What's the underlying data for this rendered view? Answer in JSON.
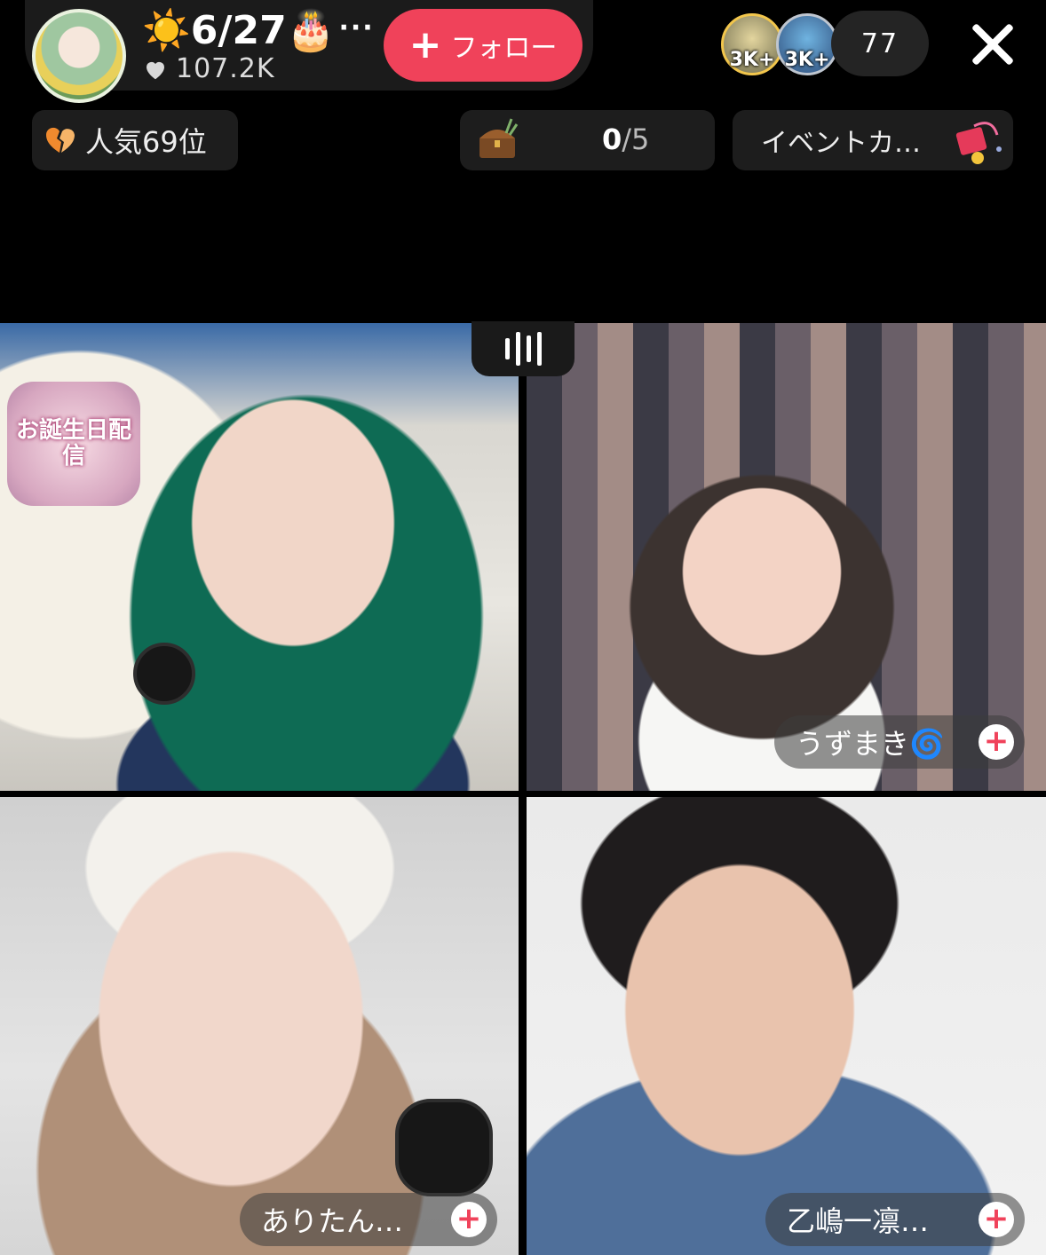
{
  "header": {
    "host_name": "☀️6/27🎂",
    "more_dots": "···",
    "likes": "107.2K",
    "follow_label": "フォロー",
    "viewer_badges": [
      "3K+",
      "3K+"
    ],
    "viewer_count": "77"
  },
  "chips": {
    "rank": "人気69位",
    "treasure_count": "0",
    "treasure_total": "/5",
    "event": "イベントカ…"
  },
  "sticker_text": "お誕生日配信",
  "participants": [
    {
      "name": "うずまき🌀"
    },
    {
      "name": "ありたん…"
    },
    {
      "name": "乙嶋一凛…"
    }
  ],
  "colors": {
    "follow": "#f0425a",
    "background": "#000000",
    "chip": "#1d1d1d"
  }
}
